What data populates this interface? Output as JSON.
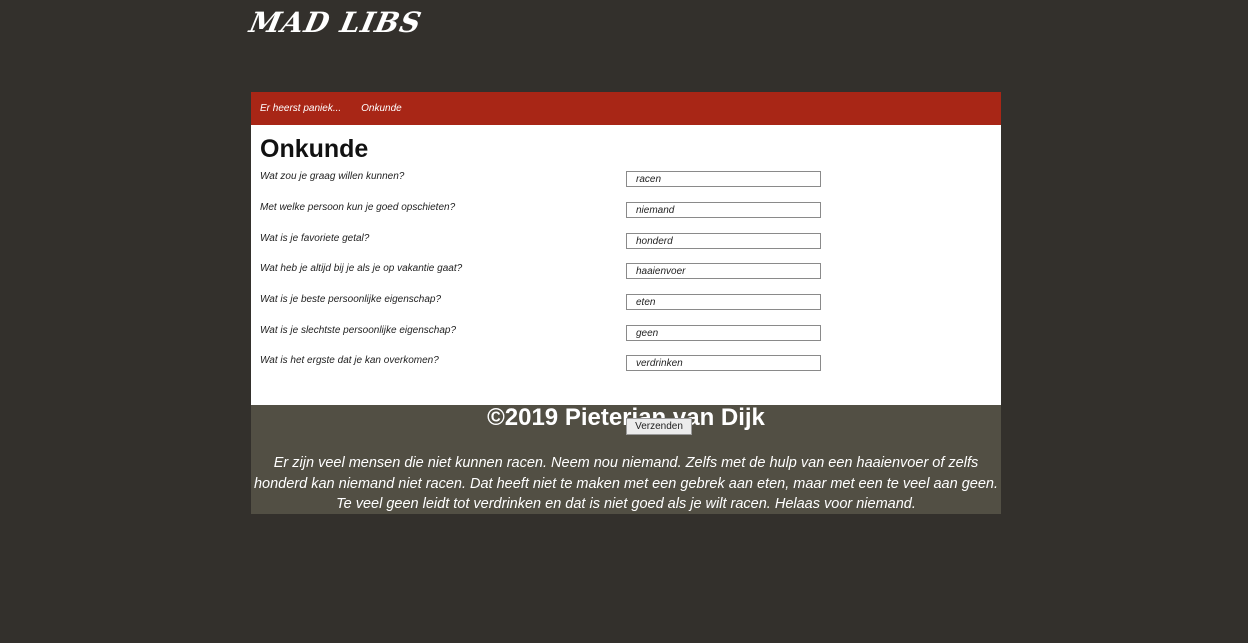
{
  "header": {
    "logo_text": "MAD LIBS"
  },
  "nav": {
    "items": [
      {
        "label": "Er heerst paniek..."
      },
      {
        "label": "Onkunde"
      }
    ]
  },
  "main": {
    "title": "Onkunde",
    "questions": [
      {
        "label": "Wat zou je graag willen kunnen?",
        "value": "racen"
      },
      {
        "label": "Met welke persoon kun je goed opschieten?",
        "value": "niemand"
      },
      {
        "label": "Wat is je favoriete getal?",
        "value": "honderd"
      },
      {
        "label": "Wat heb je altijd bij je als je op vakantie gaat?",
        "value": "haaienvoer"
      },
      {
        "label": "Wat is je beste persoonlijke eigenschap?",
        "value": "eten"
      },
      {
        "label": "Wat is je slechtste persoonlijke eigenschap?",
        "value": "geen"
      },
      {
        "label": "Wat is het ergste dat je kan overkomen?",
        "value": "verdrinken"
      }
    ],
    "submit_label": "Verzenden"
  },
  "footer": {
    "copyright": "©2019 Pieterjan van Dijk",
    "story": "Er zijn veel mensen die niet kunnen racen. Neem nou niemand. Zelfs met de hulp van een haaienvoer of zelfs honderd kan niemand niet racen. Dat heeft niet te maken met een gebrek aan eten, maar met een te veel aan geen. Te veel geen leidt tot verdrinken en dat is niet goed als je wilt racen. Helaas voor niemand."
  },
  "colors": {
    "page_background": "#33302c",
    "nav_background": "#a82616",
    "footer_background": "#524f44"
  }
}
